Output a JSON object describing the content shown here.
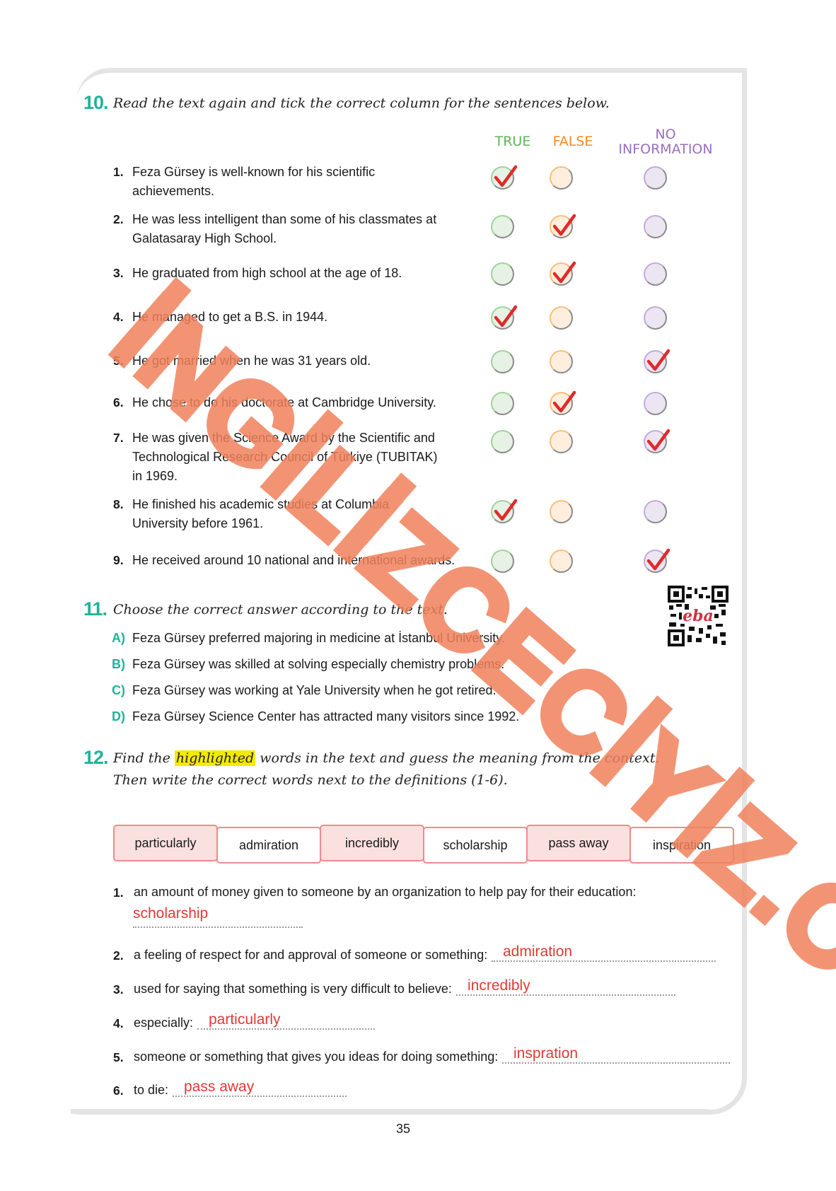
{
  "page_number": "35",
  "watermark": "İNGİLİZCECİYİZ.COM",
  "colors": {
    "accent_teal": "#1fb39a",
    "true_green": "#5db55a",
    "false_orange": "#f28a1f",
    "noinfo_purple": "#9a6fc0",
    "tick_red": "#e02a2a",
    "answer_red": "#e03a36",
    "word_pink": "#fbe0e0",
    "highlight_yellow": "#f4ea00"
  },
  "q10": {
    "number": "10.",
    "instruction": "Read the text again and tick the correct column for the sentences below.",
    "columns": {
      "true": "TRUE",
      "false": "FALSE",
      "no_info_line1": "NO",
      "no_info_line2": "INFORMATION"
    },
    "rows": [
      {
        "num": "1.",
        "lines": [
          "Feza Gürsey is well-known for his scientific",
          "achievements."
        ],
        "answer": "true"
      },
      {
        "num": "2.",
        "lines": [
          "He was less intelligent than some of his classmates at",
          "Galatasaray High School."
        ],
        "answer": "false"
      },
      {
        "num": "3.",
        "lines": [
          "He graduated from high school at the age of 18."
        ],
        "answer": "false"
      },
      {
        "num": "4.",
        "lines": [
          "He managed to get a B.S. in 1944."
        ],
        "answer": "true"
      },
      {
        "num": "5.",
        "lines": [
          "He got married when he was 31 years old."
        ],
        "answer": "no_info"
      },
      {
        "num": "6.",
        "lines": [
          "He chose to do his doctorate at Cambridge University."
        ],
        "answer": "false"
      },
      {
        "num": "7.",
        "lines": [
          "He was given the Science Award by the Scientific and",
          "Technological Research Council of Türkiye (TUBITAK)",
          "in 1969."
        ],
        "answer": "no_info"
      },
      {
        "num": "8.",
        "lines": [
          "He finished his academic studies at Columbia",
          "University before 1961."
        ],
        "answer": "true"
      },
      {
        "num": "9.",
        "lines": [
          "He received around 10 national and international awards."
        ],
        "answer": "no_info"
      }
    ]
  },
  "q11": {
    "number": "11.",
    "instruction": "Choose the correct answer according to the text.",
    "options": [
      {
        "letter": "A)",
        "text": "Feza Gürsey preferred majoring in medicine at İstanbul University."
      },
      {
        "letter": "B)",
        "text": "Feza Gürsey was skilled at solving especially chemistry problems."
      },
      {
        "letter": "C)",
        "text": "Feza Gürsey was working at Yale University when he got retired."
      },
      {
        "letter": "D)",
        "text": "Feza Gürsey Science Center has attracted many visitors since 1992."
      }
    ],
    "qr_label": "eba"
  },
  "q12": {
    "number": "12.",
    "instruction_pre": "Find the",
    "instruction_highlight": "highlighted",
    "instruction_post": "words in the text and guess the meaning from the context.",
    "instruction_line2": "Then write the correct words next to the definitions (1-6).",
    "word_bank": [
      "particularly",
      "admiration",
      "incredibly",
      "scholarship",
      "pass away",
      "inspiration"
    ],
    "definitions": [
      {
        "num": "1.",
        "text": "an amount of money given to someone by an organization to help pay for their education:",
        "answer": "scholarship"
      },
      {
        "num": "2.",
        "text": "a feeling of respect for and approval of someone or something:",
        "answer": "admiration"
      },
      {
        "num": "3.",
        "text": "used for saying that something is very difficult to believe:",
        "answer": "incredibly"
      },
      {
        "num": "4.",
        "text": "especially:",
        "answer": "particularly"
      },
      {
        "num": "5.",
        "text": "someone or something that gives you ideas for doing something:",
        "answer": "inspration"
      },
      {
        "num": "6.",
        "text": "to die:",
        "answer": "pass away"
      }
    ]
  }
}
